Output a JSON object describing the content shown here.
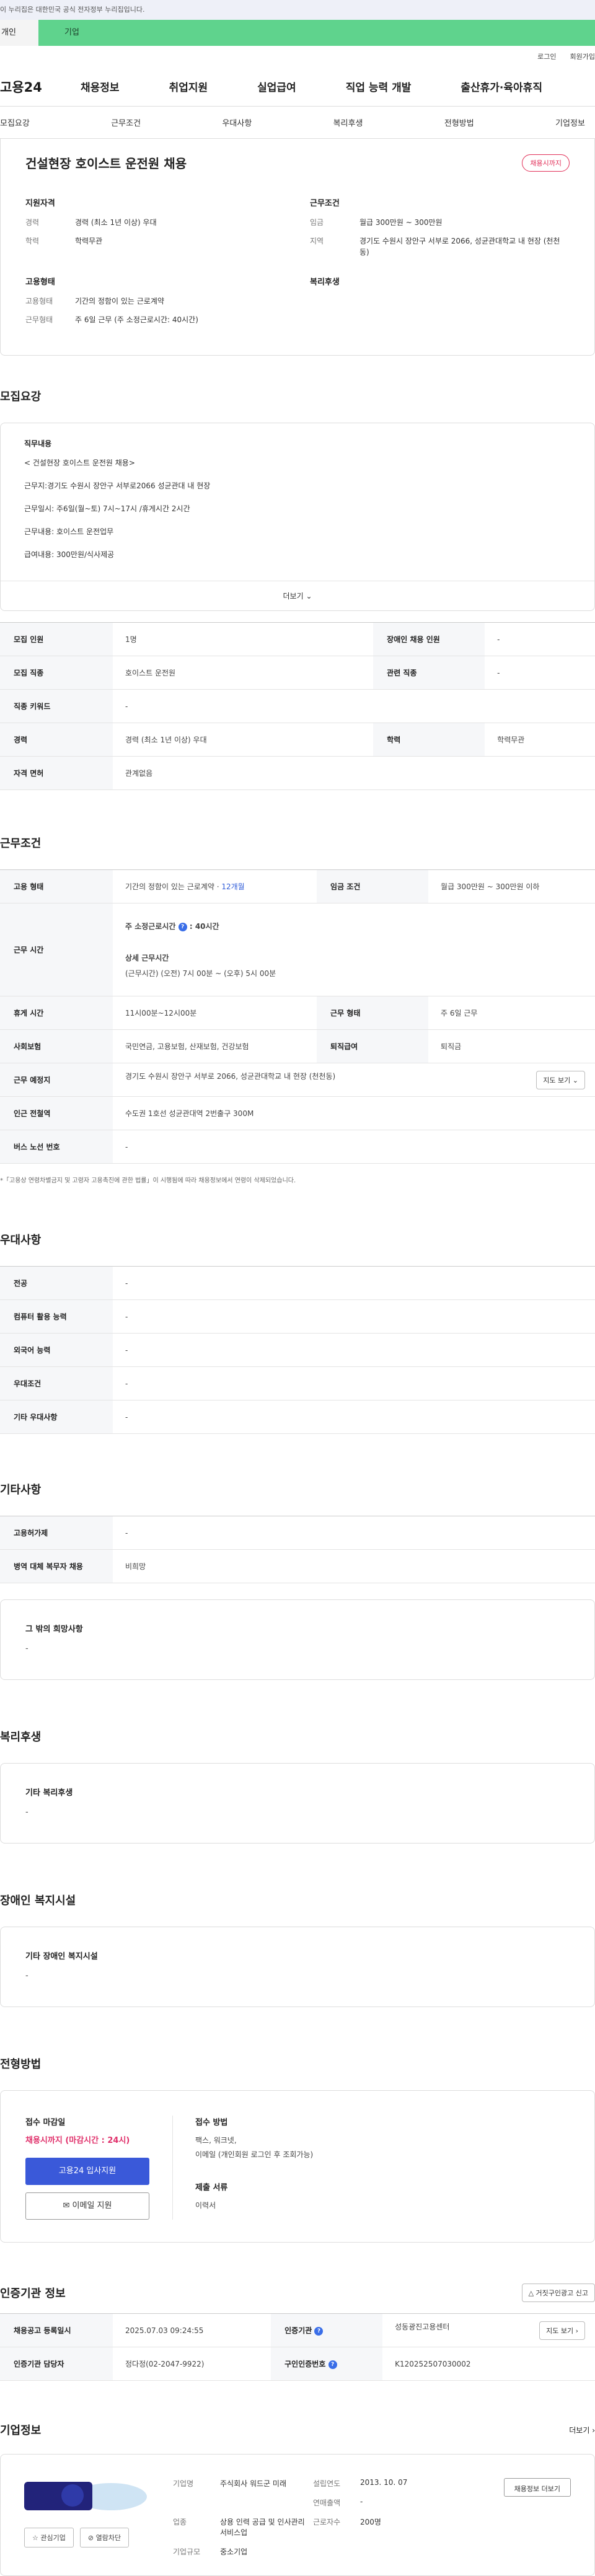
{
  "gov_banner": "이 누리집은 대한민국 공식 전자정부 누리집입니다.",
  "member_tabs": {
    "personal": "개인",
    "corporate": "기업"
  },
  "util": {
    "login": "로그인",
    "signup": "회원가입"
  },
  "logo": "고용24",
  "gnb": [
    "채용정보",
    "취업지원",
    "실업급여",
    "직업 능력 개발",
    "출산휴가·육아휴직"
  ],
  "anchor_tabs": [
    "모집요강",
    "근무조건",
    "우대사항",
    "복리후생",
    "전형방법",
    "기업정보"
  ],
  "summary": {
    "title": "건설현장 호이스트 운전원 채용",
    "badge": "채용시까지",
    "qualification": {
      "heading": "지원자격",
      "rows": [
        {
          "k": "경력",
          "v": "경력 (최소 1년 이상) 우대"
        },
        {
          "k": "학력",
          "v": "학력무관"
        }
      ]
    },
    "condition": {
      "heading": "근무조건",
      "rows": [
        {
          "k": "임금",
          "v": "월급 300만원 ~ 300만원"
        },
        {
          "k": "지역",
          "v": "경기도 수원시 장안구 서부로 2066, 성균관대학교 내 현장 (천천동)"
        }
      ]
    },
    "employment": {
      "heading": "고용형태",
      "rows": [
        {
          "k": "고용형태",
          "v": "기간의 정함이 있는 근로계약"
        },
        {
          "k": "근무형태",
          "v": "주 6일 근무 (주 소정근로시간: 40시간)"
        }
      ]
    },
    "welfare_heading": "복리후생"
  },
  "recruit": {
    "title": "모집요강",
    "job_heading": "직무내용",
    "lines": [
      "< 건설현장 호이스트 운전원 채용>",
      "근무지:경기도 수원시 장안구 서부로2066 성균관대 내 현장",
      "근무일시: 주6일(월~토) 7시~17시 /휴게시간 2시간",
      "근무내용: 호이스트 운전업무",
      "급여내용: 300만원/식사제공"
    ],
    "more": "더보기",
    "table": [
      [
        "모집 인원",
        "1명",
        "장애인 채용 인원",
        "-"
      ],
      [
        "모집 직종",
        "호이스트 운전원",
        "관련 직종",
        "-"
      ],
      [
        "직종 키워드",
        "-"
      ],
      [
        "경력",
        "경력 (최소 1년 이상) 우대",
        "학력",
        "학력무관"
      ],
      [
        "자격 면허",
        "관계없음"
      ]
    ]
  },
  "work": {
    "title": "근무조건",
    "emp_type_label": "고용 형태",
    "emp_type_value": "기간의 정함이 있는 근로계약 · ",
    "emp_type_period": "12개월",
    "wage_label": "임금 조건",
    "wage_value": "월급 300만원 ~ 300만원 이하",
    "hours_label": "근무 시간",
    "hours_main_label": "주 소정근로시간",
    "hours_main_value": ": 40시간",
    "hours_detail_label": "상세 근무시간",
    "hours_detail_value": "(근무시간) (오전) 7시 00분 ~ (오후) 5시 00분",
    "break_label": "휴게 시간",
    "break_value": "11시00분~12시00분",
    "shift_label": "근무 형태",
    "shift_value": "주 6일 근무",
    "insurance_label": "사회보험",
    "insurance_value": "국민연금, 고용보험, 산재보험, 건강보험",
    "severance_label": "퇴직급여",
    "severance_value": "퇴직금",
    "place_label": "근무 예정지",
    "place_value": "경기도 수원시 장안구 서부로 2066, 성균관대학교 내 현장 (천천동)",
    "map_btn": "지도 보기",
    "station_label": "인근 전철역",
    "station_value": "수도권 1호선 성균관대역 2번출구 300M",
    "bus_label": "버스 노선 번호",
    "bus_value": "-",
    "note": "*「고용상 연령차별금지 및 고령자 고용촉진에 관한 법률」이 시행됨에 따라 채용정보에서 연령이 삭제되었습니다."
  },
  "preferred": {
    "title": "우대사항",
    "rows": [
      [
        "전공",
        "-"
      ],
      [
        "컴퓨터 활용 능력",
        "-"
      ],
      [
        "외국어 능력",
        "-"
      ],
      [
        "우대조건",
        "-"
      ],
      [
        "기타 우대사항",
        "-"
      ]
    ]
  },
  "etc": {
    "title": "기타사항",
    "rows": [
      [
        "고용허가제",
        "-"
      ],
      [
        "병역 대체 복무자 채용",
        "비희망"
      ]
    ],
    "other_heading": "그 밖의 희망사항",
    "other_value": "-"
  },
  "benefits": {
    "title": "복리후생",
    "heading": "기타 복리후생",
    "value": "-"
  },
  "disabled": {
    "title": "장애인 복지시설",
    "heading": "기타 장애인 복지시설",
    "value": "-"
  },
  "screening": {
    "title": "전형방법",
    "deadline_heading": "접수 마감일",
    "deadline": "채용시까지 (마감시간 : 24시)",
    "apply_btn": "고용24 입사지원",
    "email_btn": "이메일 지원",
    "method_heading": "접수 방법",
    "method_lines": [
      "팩스, 워크넷,",
      "이메일 (개인회원 로그인 후 조회가능)"
    ],
    "docs_heading": "제출 서류",
    "docs_value": "이력서"
  },
  "agency": {
    "title": "인증기관 정보",
    "report_btn": "거짓구인광고 신고",
    "table": [
      [
        "채용공고 등록일시",
        "2025.07.03 09:24:55",
        "인증기관",
        "성동광진고용센터"
      ],
      [
        "인증기관 담당자",
        "정다정(02-2047-9922)",
        "구인인증번호",
        "K120252507030002"
      ]
    ],
    "map_btn": "지도 보기"
  },
  "company": {
    "title": "기업정보",
    "more": "더보기",
    "fav_btn": "관심기업",
    "block_btn": "열람차단",
    "name_label": "기업명",
    "name_value": "주식회사 워드군 미래",
    "founded_label": "설립연도",
    "founded_value": "2013. 10. 07",
    "revenue_label": "연매출액",
    "revenue_value": "-",
    "industry_label": "업종",
    "industry_value": "상용 인력 공급 및 인사관리 서비스업",
    "employees_label": "근로자수",
    "employees_value": "200명",
    "size_label": "기업규모",
    "size_value": "중소기업",
    "jobs_btn": "채용정보 더보기"
  }
}
